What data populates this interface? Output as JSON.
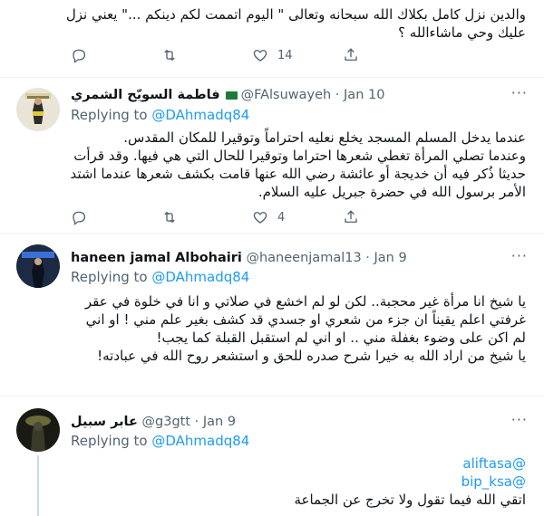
{
  "tweet0": {
    "text_lines": [
      "والدين نزل كامل بكلاك الله سبحانه وتعالى \" اليوم اتممت لكم دينكم ...\" يعني نزل",
      "عليك وحي ماشاءالله ؟"
    ],
    "like_count": "14"
  },
  "tweet1": {
    "display_name": "فاطمة السويّح الشمري",
    "handle": "@FAlsuwayeh",
    "date": "Jan 10",
    "replying_prefix": "Replying to",
    "replying_handle": "@DAhmadq84",
    "text_lines": [
      "عندما يدخل المسلم المسجد يخلع نعليه احتراماً وتوقيرا للمكان المقدس.",
      "وعندما تصلي المرأة تغطي شعرها احتراما وتوقيرا للحال التي هي فيها. وقد قرأت",
      "حديثا ذُكر فيه أن خديجة أو عائشة رضي الله عنها قامت بكشف شعرها عندما اشتد",
      "الأمر برسول الله في حضرة جبريل عليه السلام."
    ],
    "like_count": "4"
  },
  "tweet2": {
    "display_name": "haneen jamal Albohairi",
    "handle": "@haneenjamal13",
    "date": "Jan 9",
    "replying_prefix": "Replying to",
    "replying_handle": "@DAhmadq84",
    "text_lines": [
      "يا شيخ انا مرأة غير محجبة.. لكن لو لم اخشع في صلاتي و انا في خلوة في عقر",
      "غرفتي اعلم يقيناً ان جزء من شعري او جسدي قد كشف بغير علم مني ! او اني",
      "لم اكن على وضوء بغفلة مني .. او اني لم استقبل القبلة كما يجب!",
      "يا شيخ من اراد الله به خيرا شرح صدره للحق و استشعر روح الله في عبادته!"
    ]
  },
  "tweet3": {
    "display_name": "عابر سبيل",
    "handle": "@g3gtt",
    "date": "Jan 9",
    "replying_prefix": "Replying to",
    "replying_handle": "@DAhmadq84",
    "mentions": [
      "@aliftasa",
      "@bip_ksa"
    ],
    "text_line": "اتقي الله فيما تقول ولا تخرج عن الجماعة"
  },
  "colors": {
    "accent": "#1d9bf0",
    "muted": "#536471",
    "text": "#0f1419"
  },
  "icons": [
    "reply-icon",
    "retweet-icon",
    "like-icon",
    "share-icon",
    "more-icon"
  ]
}
